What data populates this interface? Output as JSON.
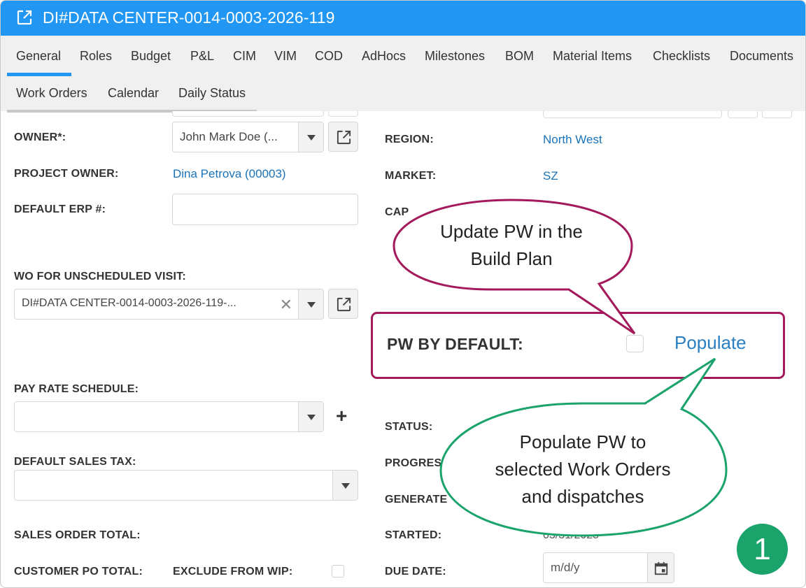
{
  "window": {
    "title": "DI#DATA CENTER-0014-0003-2026-119"
  },
  "tabs": [
    {
      "label": "General",
      "active": true
    },
    {
      "label": "Roles"
    },
    {
      "label": "Budget"
    },
    {
      "label": "P&L"
    },
    {
      "label": "CIM"
    },
    {
      "label": "VIM"
    },
    {
      "label": "COD"
    },
    {
      "label": "AdHocs"
    },
    {
      "label": "Milestones"
    },
    {
      "label": "BOM"
    },
    {
      "label": "Material Items"
    },
    {
      "label": "Checklists"
    },
    {
      "label": "Documents"
    }
  ],
  "subtabs": [
    {
      "label": "Work Orders"
    },
    {
      "label": "Calendar"
    },
    {
      "label": "Daily Status"
    }
  ],
  "left": {
    "owner_label": "OWNER*:",
    "owner_value": "John Mark Doe (...",
    "project_owner_label": "PROJECT OWNER:",
    "project_owner_value": "Dina Petrova (00003)",
    "default_erp_label": "DEFAULT ERP #:",
    "default_erp_value": "",
    "wo_unscheduled_label": "WO FOR UNSCHEDULED VISIT:",
    "wo_unscheduled_value": "DI#DATA CENTER-0014-0003-2026-119-...",
    "pay_rate_label": "PAY RATE SCHEDULE:",
    "pay_rate_value": "",
    "sales_tax_label": "DEFAULT SALES TAX:",
    "sales_tax_value": "",
    "sales_order_total_label": "SALES ORDER TOTAL:",
    "customer_po_total_label": "CUSTOMER PO TOTAL:",
    "exclude_wip_label": "EXCLUDE FROM WIP:"
  },
  "right": {
    "region_label": "REGION:",
    "region_value": "North West",
    "market_label": "MARKET:",
    "market_value": "SZ",
    "capacity_label": "CAP",
    "pw_default_label": "PW BY DEFAULT:",
    "populate_label": "Populate",
    "status_label": "STATUS:",
    "progress_label": "PROGRES",
    "generated_label": "GENERATE",
    "started_label": "STARTED:",
    "started_value": "03/31/2025",
    "due_date_label": "DUE DATE:",
    "due_date_placeholder": "m/d/y"
  },
  "callouts": {
    "top_line1": "Update PW in the",
    "top_line2": "Build Plan",
    "bottom_line1": "Populate PW to",
    "bottom_line2": "selected Work Orders",
    "bottom_line3": "and dispatches",
    "badge": "1",
    "colors": {
      "top": "#a3195b",
      "bottom": "#1aa36a",
      "accent": "#2196f3"
    }
  }
}
